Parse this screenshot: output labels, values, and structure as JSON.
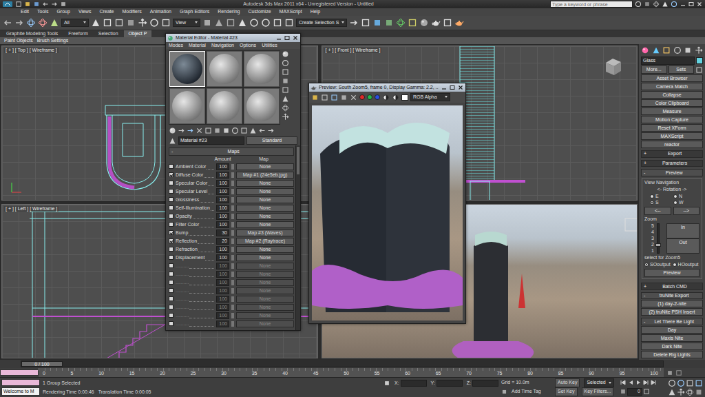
{
  "window": {
    "title": "Autodesk 3ds Max 2011 x64 - Unregistered Version - Untitled",
    "search_placeholder": "Type a keyword or phrase"
  },
  "menu": [
    "Edit",
    "Tools",
    "Group",
    "Views",
    "Create",
    "Modifiers",
    "Animation",
    "Graph Editors",
    "Rendering",
    "Customize",
    "MAXScript",
    "Help"
  ],
  "toolbar": {
    "selection_filter": "All",
    "reference_coordinate": "View",
    "named_selection": "Create Selection S"
  },
  "ribbon": {
    "tabs": [
      {
        "label": "Graphite Modeling Tools",
        "selected": false
      },
      {
        "label": "Freeform",
        "selected": false
      },
      {
        "label": "Selection",
        "selected": false
      },
      {
        "label": "Object P",
        "selected": true
      }
    ],
    "panels": [
      "Paint Objects",
      "Brush Settings"
    ]
  },
  "viewports": [
    {
      "label": "[ + ] [ Top ] [ Wireframe ]",
      "kind": "top"
    },
    {
      "label": "[ + ] [ Front ] [ Wireframe ]",
      "kind": "front"
    },
    {
      "label": "[ + ] [ Left ] [ Wireframe ]",
      "kind": "left"
    },
    {
      "kind": "perspective"
    }
  ],
  "material_editor": {
    "title": "Material Editor - Material #23",
    "menu": [
      "Modes",
      "Material",
      "Navigation",
      "Options",
      "Utilities"
    ],
    "slots": [
      {
        "selected": true
      },
      {
        "selected": false
      },
      {
        "selected": false
      },
      {
        "selected": false
      },
      {
        "selected": false
      },
      {
        "selected": false
      }
    ],
    "material_name": "Material #23",
    "material_type": "Standard",
    "rollout": {
      "sign": "-",
      "label": "Maps",
      "expanded": true
    },
    "columns": [
      "Amount",
      "Map"
    ],
    "maps": [
      {
        "label": "Ambient Color",
        "enabled": false,
        "greyed": false,
        "amount": "100",
        "map": "None"
      },
      {
        "label": "Diffuse Color",
        "enabled": true,
        "greyed": false,
        "amount": "100",
        "map": "Map #1 (24e5eb.jpg)"
      },
      {
        "label": "Specular Color",
        "enabled": false,
        "greyed": false,
        "amount": "100",
        "map": "None"
      },
      {
        "label": "Specular Level",
        "enabled": false,
        "greyed": false,
        "amount": "100",
        "map": "None"
      },
      {
        "label": "Glossiness",
        "enabled": false,
        "greyed": false,
        "amount": "100",
        "map": "None"
      },
      {
        "label": "Self-Illumination",
        "enabled": false,
        "greyed": false,
        "amount": "100",
        "map": "None"
      },
      {
        "label": "Opacity",
        "enabled": false,
        "greyed": false,
        "amount": "100",
        "map": "None"
      },
      {
        "label": "Filter Color",
        "enabled": false,
        "greyed": false,
        "amount": "100",
        "map": "None"
      },
      {
        "label": "Bump",
        "enabled": true,
        "greyed": false,
        "amount": "30",
        "map": "Map #3 (Waves)"
      },
      {
        "label": "Reflection",
        "enabled": true,
        "greyed": false,
        "amount": "20",
        "map": "Map #2 (Raytrace)"
      },
      {
        "label": "Refraction",
        "enabled": false,
        "greyed": false,
        "amount": "100",
        "map": "None"
      },
      {
        "label": "Displacement",
        "enabled": false,
        "greyed": false,
        "amount": "100",
        "map": "None"
      },
      {
        "label": "..........",
        "enabled": false,
        "greyed": true,
        "amount": "100",
        "map": "None"
      },
      {
        "label": "..........",
        "enabled": false,
        "greyed": true,
        "amount": "100",
        "map": "None"
      },
      {
        "label": "..........",
        "enabled": false,
        "greyed": true,
        "amount": "100",
        "map": "None"
      },
      {
        "label": "..........",
        "enabled": false,
        "greyed": true,
        "amount": "100",
        "map": "None"
      },
      {
        "label": "..........",
        "enabled": false,
        "greyed": true,
        "amount": "100",
        "map": "None"
      },
      {
        "label": "..........",
        "enabled": false,
        "greyed": true,
        "amount": "100",
        "map": "None"
      },
      {
        "label": "..........",
        "enabled": false,
        "greyed": true,
        "amount": "100",
        "map": "None"
      },
      {
        "label": "..........",
        "enabled": false,
        "greyed": true,
        "amount": "100",
        "map": "None"
      }
    ]
  },
  "preview": {
    "title": "Preview: South Zoom5, frame 0, Display Gamma: 2.2, ...",
    "channels": [
      {
        "color": "#e02828"
      },
      {
        "color": "#22b84a"
      },
      {
        "color": "#2a4ee0"
      }
    ],
    "display": "RGB Alpha"
  },
  "command_panel": {
    "object_name": "Glass",
    "buttons": [
      "More...",
      "Sets"
    ],
    "utilities": [
      "Asset Browser",
      "Camera Match",
      "Collapse",
      "Color Clipboard",
      "Measure",
      "Motion Capture",
      "Reset XForm",
      "MAXScript",
      "reactor"
    ],
    "export": {
      "sign": "+",
      "label": "Export",
      "expanded": false
    },
    "parameters": {
      "sign": "+",
      "label": "Parameters",
      "expanded": false
    },
    "preview": {
      "sign": "-",
      "label": "Preview",
      "expanded": true,
      "group": "View Navigation",
      "rotation": "<- Rotation ->",
      "directions": [
        {
          "label": "E",
          "selected": false
        },
        {
          "label": "N",
          "selected": false
        },
        {
          "label": "S",
          "selected": true
        },
        {
          "label": "W",
          "selected": false
        }
      ],
      "rotate_left": "<--",
      "rotate_right": "-->",
      "zoom_label": "Zoom",
      "zoom_ticks": [
        "5",
        "4",
        "3",
        "2",
        "1"
      ],
      "zoom_level": 0.25,
      "zoom_in": "In",
      "zoom_out": "Out",
      "select_label": "select for Zoom5",
      "outputs": [
        {
          "label": "SOoutput",
          "selected": true
        },
        {
          "label": "HOoutput",
          "selected": false
        }
      ],
      "preview_button": "Preview"
    },
    "batch": {
      "sign": "+",
      "label": "Batch CMD",
      "expanded": false
    },
    "trunite": {
      "sign": "-",
      "label": "truNite Export",
      "expanded": true,
      "buttons": [
        "(1) day-2-nite",
        "(2) truNite PSH Insert"
      ]
    },
    "lights": {
      "sign": "-",
      "label": "Let There Be Light",
      "expanded": true,
      "buttons": [
        "Day",
        "Maxis Nite",
        "Dark Nite",
        "Delete Rig Lights"
      ]
    }
  },
  "timeline": {
    "position": "0 / 100",
    "level": 0,
    "ticks": [
      "0",
      "5",
      "10",
      "15",
      "20",
      "25",
      "30",
      "35",
      "40",
      "45",
      "50",
      "55",
      "60",
      "65",
      "70",
      "75",
      "80",
      "85",
      "90",
      "95",
      "100"
    ]
  },
  "status_bar": {
    "listener": "Welcome to M",
    "selection": "1 Group Selected",
    "rendering_time": "Rendering Time  0:00:46",
    "translation_time": "Translation Time  0:00:05",
    "coords": [
      "X:",
      "Y:",
      "Z:"
    ],
    "grid": "Grid = 10.0m",
    "time_tag": "Add Time Tag",
    "auto_key": {
      "label": "Auto Key",
      "on": false
    },
    "key_mode": "Selected",
    "set_key": "Set Key",
    "key_filters": "Key Filters...",
    "frame": "0"
  }
}
